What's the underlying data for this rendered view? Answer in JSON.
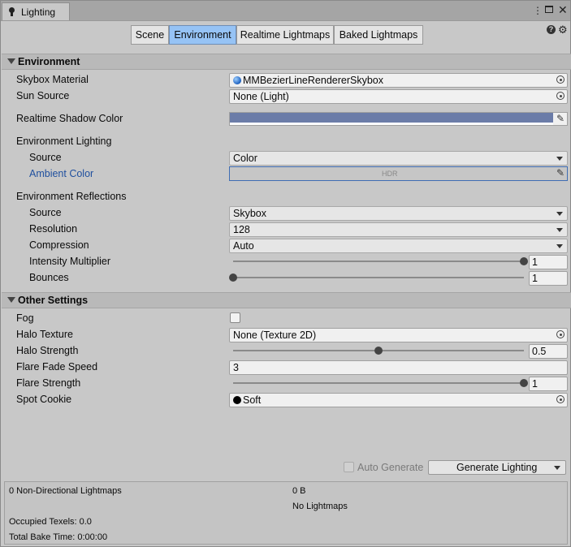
{
  "window": {
    "tab_title": "Lighting",
    "toolbar_icons": [
      "more-options-icon",
      "maximize-icon",
      "close-icon"
    ]
  },
  "tabs": [
    {
      "label": "Scene",
      "active": false
    },
    {
      "label": "Environment",
      "active": true
    },
    {
      "label": "Realtime Lightmaps",
      "active": false
    },
    {
      "label": "Baked Lightmaps",
      "active": false
    }
  ],
  "environment": {
    "header": "Environment",
    "skybox_material": {
      "label": "Skybox Material",
      "value": "MMBezierLineRendererSkybox"
    },
    "sun_source": {
      "label": "Sun Source",
      "value": "None (Light)"
    },
    "shadow_color": {
      "label": "Realtime Shadow Color",
      "color": "#6b7ca8"
    },
    "env_lighting": {
      "label": "Environment Lighting"
    },
    "lighting_source": {
      "label": "Source",
      "value": "Color"
    },
    "ambient_color": {
      "label": "Ambient Color",
      "value": "HDR"
    },
    "env_reflections": {
      "label": "Environment Reflections"
    },
    "refl_source": {
      "label": "Source",
      "value": "Skybox"
    },
    "resolution": {
      "label": "Resolution",
      "value": "128"
    },
    "compression": {
      "label": "Compression",
      "value": "Auto"
    },
    "intensity": {
      "label": "Intensity Multiplier",
      "value": "1",
      "fraction": 1.0
    },
    "bounces": {
      "label": "Bounces",
      "value": "1",
      "fraction": 0.0
    }
  },
  "other": {
    "header": "Other Settings",
    "fog": {
      "label": "Fog",
      "checked": false
    },
    "halo_texture": {
      "label": "Halo Texture",
      "value": "None (Texture 2D)"
    },
    "halo_strength": {
      "label": "Halo Strength",
      "value": "0.5",
      "fraction": 0.5
    },
    "flare_fade_speed": {
      "label": "Flare Fade Speed",
      "value": "3"
    },
    "flare_strength": {
      "label": "Flare Strength",
      "value": "1",
      "fraction": 1.0
    },
    "spot_cookie": {
      "label": "Spot Cookie",
      "value": "Soft"
    }
  },
  "bake": {
    "auto_generate": "Auto Generate",
    "generate_button": "Generate Lighting"
  },
  "stats": {
    "lightmaps": "0 Non-Directional Lightmaps",
    "size": "0 B",
    "no_lightmaps": "No Lightmaps",
    "texels": "Occupied Texels: 0.0",
    "bake_time": "Total Bake Time: 0:00:00"
  },
  "colors": {
    "accent_tab": "#96c3f5",
    "ambient_label": "#1f4f9e"
  }
}
